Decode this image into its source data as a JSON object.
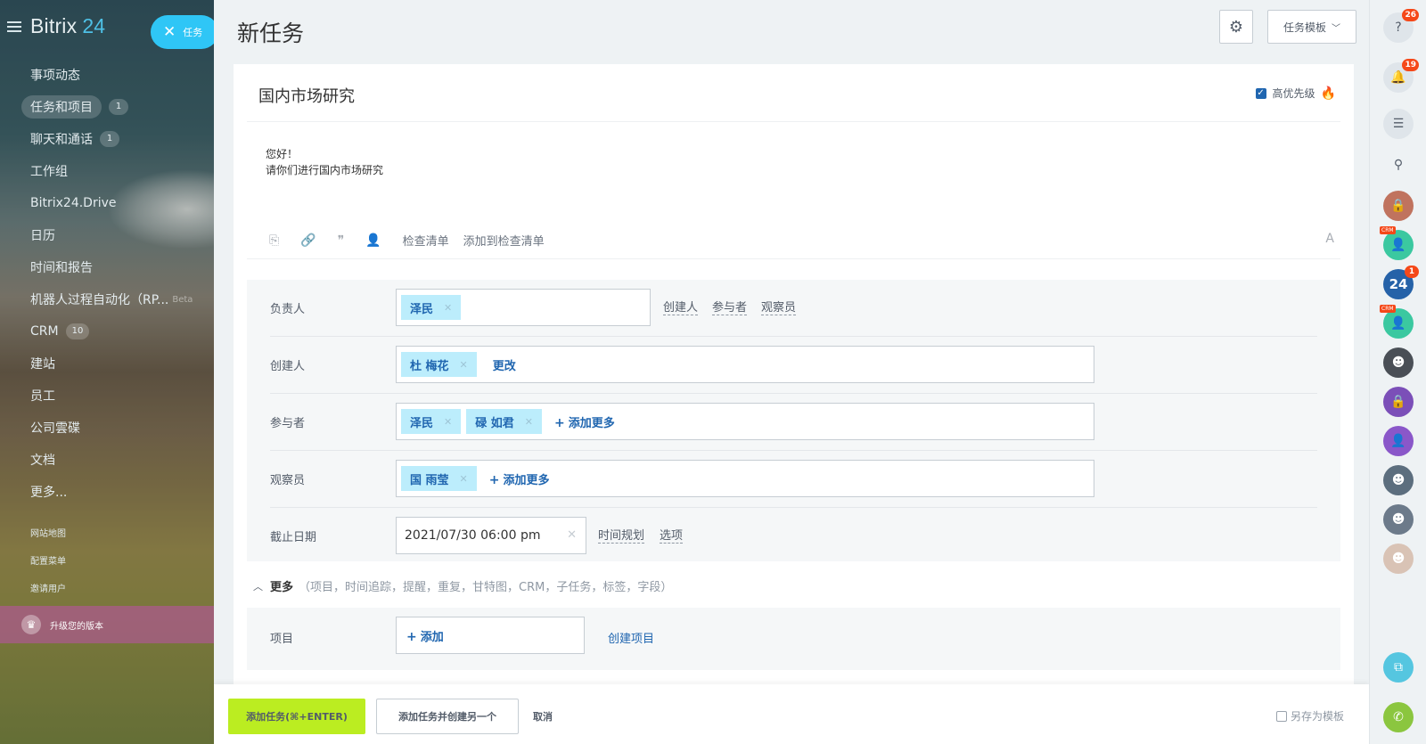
{
  "sidebar": {
    "logo_text": "Bitrix",
    "logo_num": "24",
    "task_pill_label": "任务",
    "items": [
      {
        "label": "事项动态",
        "badge": ""
      },
      {
        "label": "任务和项目",
        "badge": "1",
        "active": true
      },
      {
        "label": "聊天和通话",
        "badge": "1"
      },
      {
        "label": "工作组",
        "badge": ""
      },
      {
        "label": "Bitrix24.Drive",
        "badge": ""
      },
      {
        "label": "日历",
        "badge": ""
      },
      {
        "label": "时间和报告",
        "badge": ""
      },
      {
        "label": "机器人过程自动化（RP...",
        "badge": "",
        "beta": "Beta"
      },
      {
        "label": "CRM",
        "badge": "10"
      },
      {
        "label": "建站",
        "badge": ""
      },
      {
        "label": "员工",
        "badge": ""
      },
      {
        "label": "公司雲碟",
        "badge": ""
      },
      {
        "label": "文档",
        "badge": ""
      },
      {
        "label": "更多...",
        "badge": ""
      }
    ],
    "small_links": [
      "网站地图",
      "配置菜单",
      "邀请用户"
    ],
    "upgrade_label": "升级您的版本"
  },
  "header": {
    "title": "新任务",
    "template_button": "任务模板"
  },
  "task": {
    "title": "国内市场研究",
    "high_priority_label": "高优先级",
    "body_lines": [
      "您好！",
      "请你们进行国内市场研究"
    ],
    "toolbar": {
      "checklist": "检查清单",
      "add_to_checklist": "添加到检查清单",
      "font_icon": "A"
    }
  },
  "form": {
    "assignee": {
      "label": "负责人",
      "chips": [
        "泽民"
      ],
      "links": [
        "创建人",
        "参与者",
        "观察员"
      ]
    },
    "creator": {
      "label": "创建人",
      "chips": [
        "杜 梅花"
      ],
      "change": "更改"
    },
    "participants": {
      "label": "参与者",
      "chips": [
        "泽民",
        "碌 如君"
      ],
      "add_more": "添加更多"
    },
    "observers": {
      "label": "观察员",
      "chips": [
        "国 雨莹"
      ],
      "add_more": "添加更多"
    },
    "deadline": {
      "label": "截止日期",
      "value": "2021/07/30 06:00 pm",
      "links": [
        "时间规划",
        "选项"
      ]
    }
  },
  "more": {
    "label": "更多",
    "details": "（项目，时间追踪，提醒，重复，甘特图，CRM，子任务，标签，字段）"
  },
  "project": {
    "label": "项目",
    "add": "添加",
    "create_link": "创建项目"
  },
  "footer": {
    "primary": "添加任务(⌘+ENTER)",
    "secondary": "添加任务并创建另一个",
    "cancel": "取消",
    "save_template": "另存为模板"
  },
  "rightbar": {
    "help_count": "26",
    "notif_count": "19",
    "app24_label": "24",
    "app24_count": "1",
    "crm_tag": "CRM"
  },
  "colors": {
    "accent": "#2fc6f6",
    "primary_button": "#bbed21",
    "link": "#2066b0",
    "chip": "#bcedfc"
  }
}
